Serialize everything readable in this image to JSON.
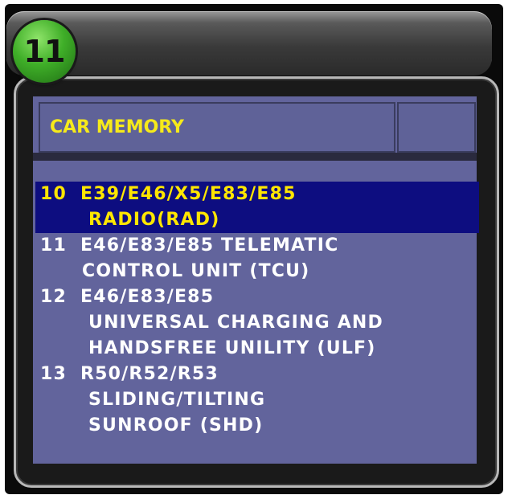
{
  "badge": {
    "number": "11"
  },
  "header": {
    "title": "CAR MEMORY",
    "aux": ""
  },
  "list": {
    "selected_index": 0,
    "items": [
      {
        "number": "10",
        "lines": [
          "E39/E46/X5/E83/E85",
          "RADIO(RAD)"
        ]
      },
      {
        "number": "11",
        "lines": [
          "E46/E83/E85 TELEMATIC",
          "CONTROL UNIT (TCU)"
        ]
      },
      {
        "number": "12",
        "lines": [
          "E46/E83/E85",
          "UNIVERSAL CHARGING AND",
          "HANDSFREE UNILITY (ULF)"
        ]
      },
      {
        "number": "13",
        "lines": [
          "R50/R52/R53",
          "SLIDING/TILTING",
          "SUNROOF (SHD)"
        ]
      }
    ]
  },
  "colors": {
    "panel": "#62649c",
    "header_text": "#f6ea1a",
    "selected_bg": "#0d0d80",
    "selected_text": "#ffe600",
    "badge": "#3fae28"
  }
}
